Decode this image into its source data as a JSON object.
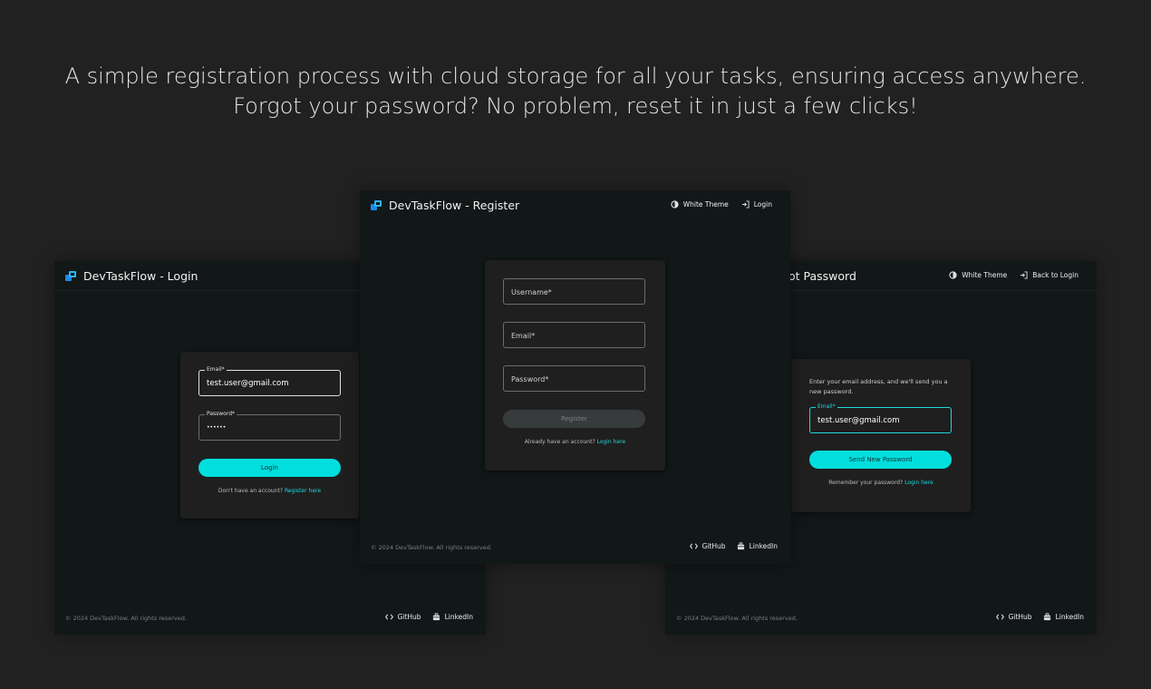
{
  "headline": {
    "line1": "A simple registration process with cloud storage for all your tasks, ensuring access anywhere.",
    "line2": "Forgot your password? No problem, reset it in just a few clicks!"
  },
  "colors": {
    "accent": "#00dede",
    "background": "#212121",
    "screen": "#121718",
    "card": "#1f1f1f"
  },
  "login_screen": {
    "brand": "DevTaskFlow - Login",
    "email_label": "Email*",
    "email_value": "test.user@gmail.com",
    "password_label": "Password*",
    "password_value": "••••••",
    "login_button": "Login",
    "helper_text": "Don't have an account?",
    "helper_link": "Register here",
    "footer_copy": "© 2024 DevTaskFlow. All rights reserved.",
    "github": "GitHub",
    "linkedin": "LinkedIn"
  },
  "register_screen": {
    "brand": "DevTaskFlow - Register",
    "theme_toggle": "White Theme",
    "nav_login": "Login",
    "username_placeholder": "Username*",
    "email_placeholder": "Email*",
    "password_placeholder": "Password*",
    "register_button": "Register",
    "helper_text": "Already have an account?",
    "helper_link": "Login here",
    "footer_copy": "© 2024 DevTaskFlow. All rights reserved.",
    "github": "GitHub",
    "linkedin": "LinkedIn"
  },
  "forgot_screen": {
    "brand_visible": "ot Password",
    "theme_toggle": "White Theme",
    "nav_back": "Back to Login",
    "description": "Enter your email address, and we'll send you a new password.",
    "email_label": "Email*",
    "email_value": "test.user@gmail.com",
    "send_button": "Send New Password",
    "helper_text": "Remember your password?",
    "helper_link": "Login here",
    "footer_copy": "© 2024 DevTaskFlow. All rights reserved.",
    "github": "GitHub",
    "linkedin": "LinkedIn"
  },
  "icons": {
    "logo": "devtaskflow-logo-icon",
    "theme": "contrast-icon",
    "login": "login-arrow-icon",
    "github": "code-icon",
    "linkedin": "briefcase-icon"
  }
}
